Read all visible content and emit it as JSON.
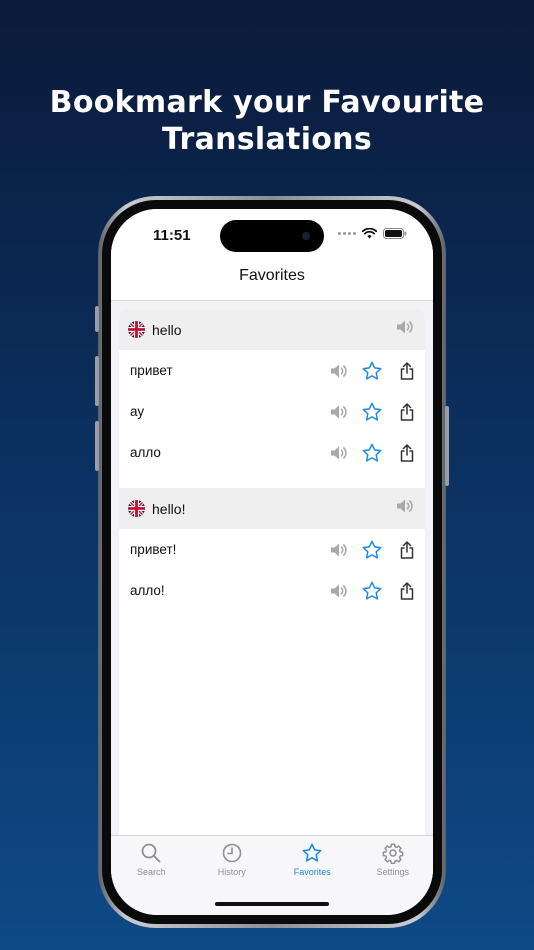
{
  "headline": {
    "line1": "Bookmark your Favourite",
    "line2": "Translations"
  },
  "status_bar": {
    "time": "11:51"
  },
  "nav": {
    "title": "Favorites"
  },
  "groups": [
    {
      "source": {
        "flag": "uk-flag",
        "text": "hello"
      },
      "translations": [
        "привет",
        "ау",
        "алло"
      ]
    },
    {
      "source": {
        "flag": "uk-flag",
        "text": "hello!"
      },
      "translations": [
        "привет!",
        "алло!"
      ]
    }
  ],
  "tabs": [
    {
      "label": "Search",
      "icon": "search-icon",
      "active": false
    },
    {
      "label": "History",
      "icon": "clock-icon",
      "active": false
    },
    {
      "label": "Favorites",
      "icon": "star-icon",
      "active": true
    },
    {
      "label": "Settings",
      "icon": "gear-icon",
      "active": false
    }
  ],
  "colors": {
    "accent": "#1e88e5",
    "inactive": "#8e8e93",
    "speaker": "#a8a8ad"
  }
}
